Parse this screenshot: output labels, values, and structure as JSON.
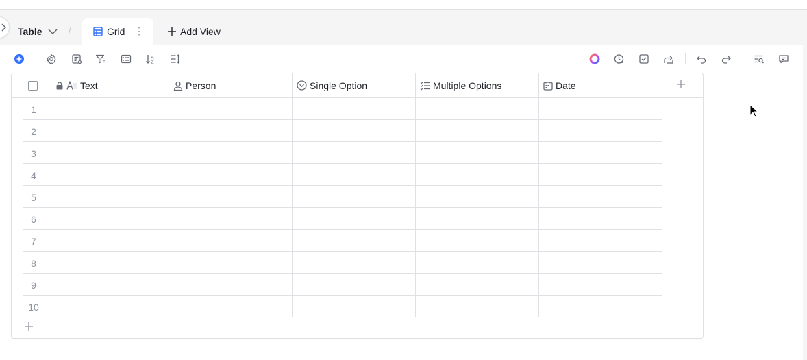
{
  "tabs": {
    "table_label": "Table",
    "separator": "/",
    "grid_label": "Grid",
    "add_view_label": "Add View"
  },
  "columns": [
    {
      "label": "Text",
      "icon": "text-field-icon",
      "locked": true
    },
    {
      "label": "Person",
      "icon": "person-icon"
    },
    {
      "label": "Single Option",
      "icon": "single-option-icon"
    },
    {
      "label": "Multiple Options",
      "icon": "multiple-options-icon"
    },
    {
      "label": "Date",
      "icon": "calendar-icon"
    }
  ],
  "rows": [
    "1",
    "2",
    "3",
    "4",
    "5",
    "6",
    "7",
    "8",
    "9",
    "10"
  ],
  "colors": {
    "accent": "#3370ff",
    "border": "#dee0e3",
    "muted": "#8f959e"
  }
}
